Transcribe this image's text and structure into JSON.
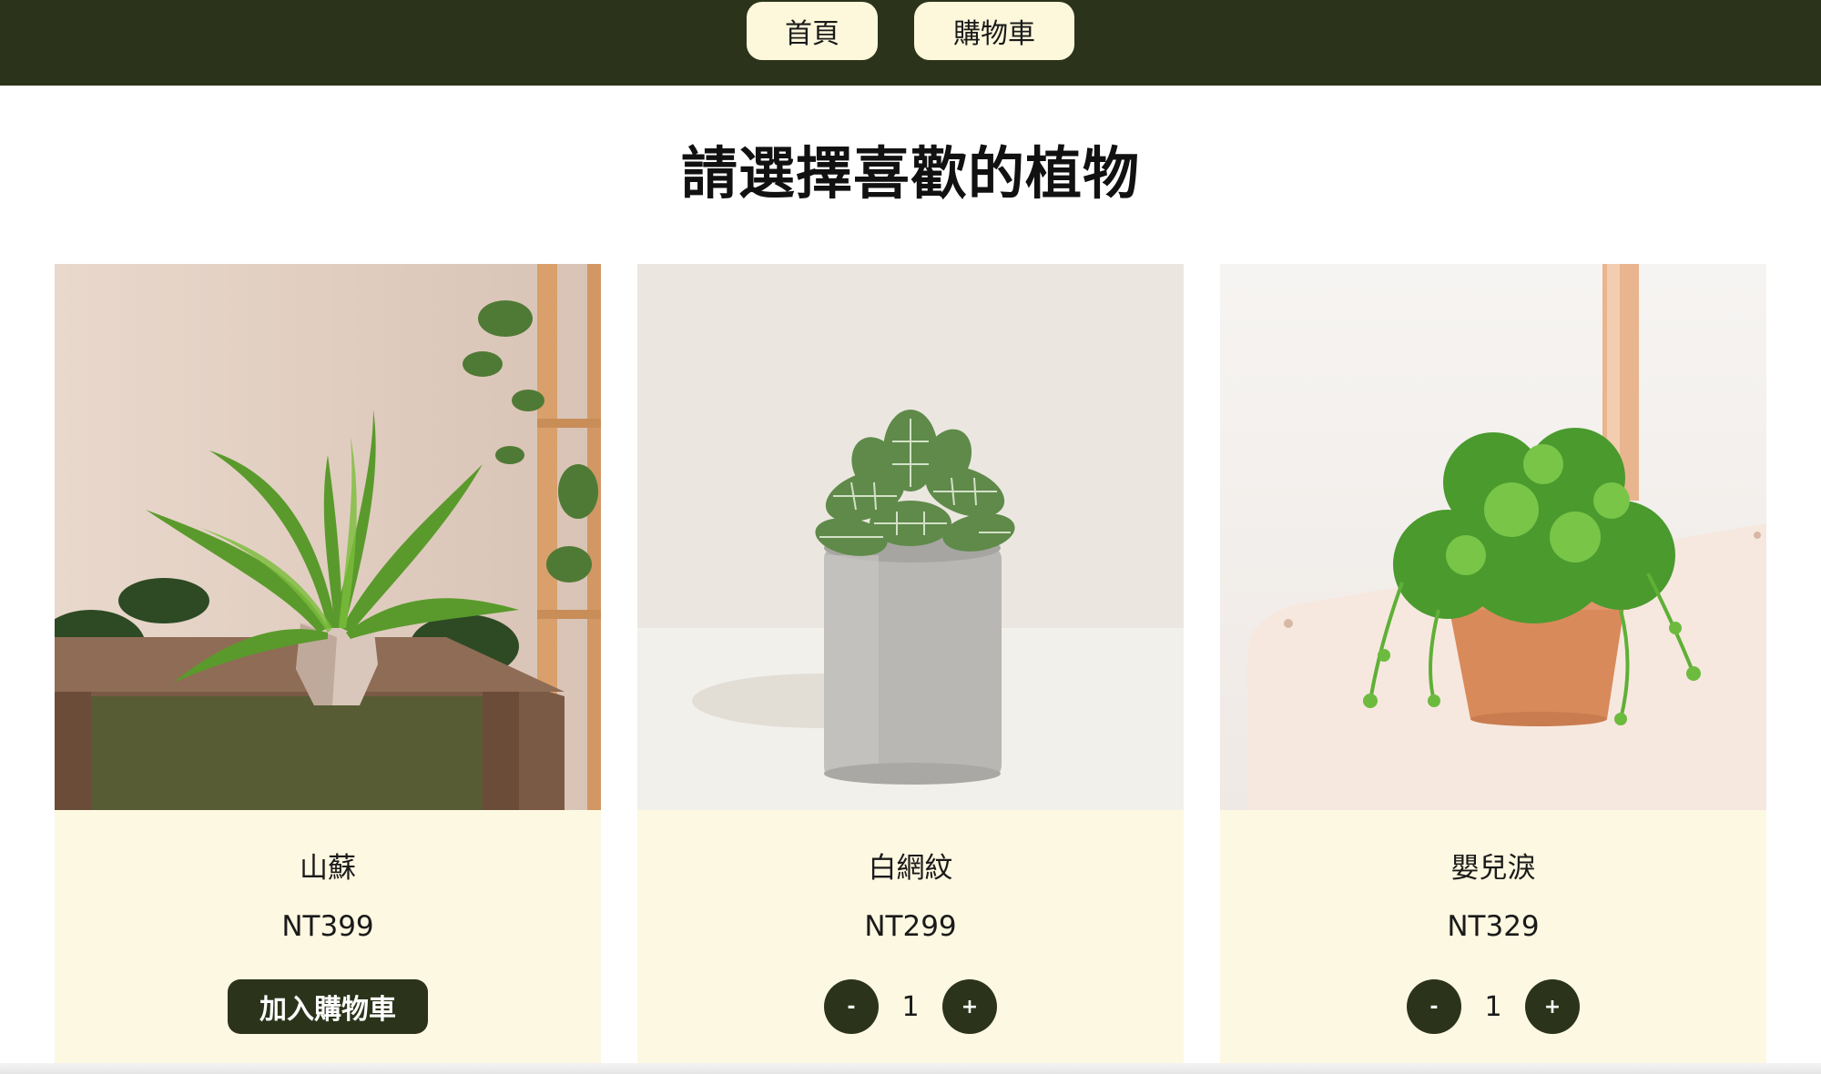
{
  "nav": {
    "home_label": "首頁",
    "cart_label": "購物車"
  },
  "page": {
    "title": "請選擇喜歡的植物"
  },
  "products": [
    {
      "name": "山蘇",
      "price": "NT399",
      "action_label": "加入購物車"
    },
    {
      "name": "白網紋",
      "price": "NT299",
      "quantity": "1",
      "minus_label": "-",
      "plus_label": "+"
    },
    {
      "name": "嬰兒淚",
      "price": "NT329",
      "quantity": "1",
      "minus_label": "-",
      "plus_label": "+"
    }
  ],
  "colors": {
    "brand_dark": "#2b341a",
    "card_background": "#fdf8e1",
    "nav_button": "#fdf8dc"
  }
}
